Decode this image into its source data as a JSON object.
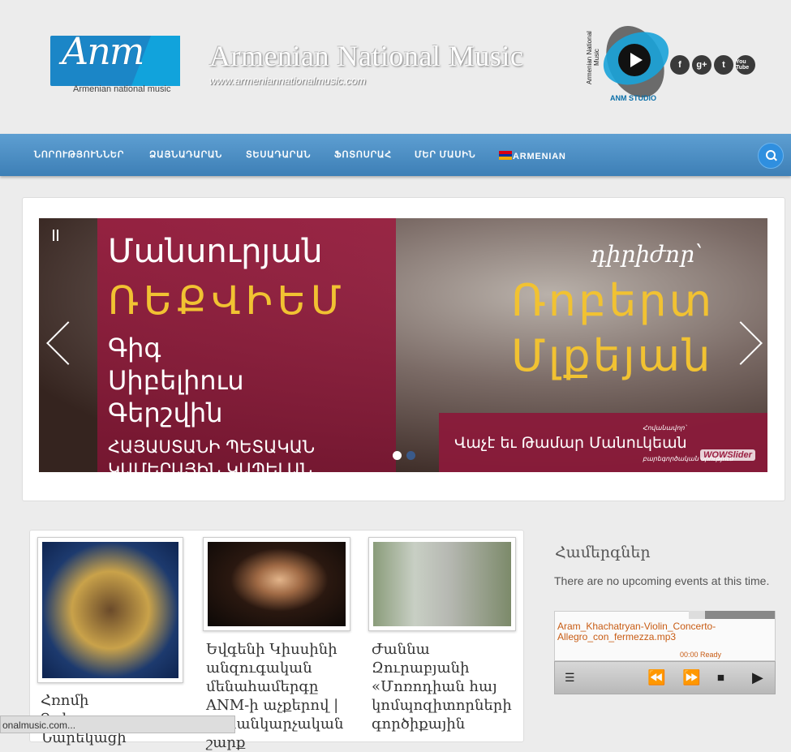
{
  "header": {
    "logo_script": "Anm",
    "logo_subtitle": "Armenian national music",
    "site_title": "Armenian National Music",
    "site_url": "www.armeniannationalmusic.com",
    "studio_vertical": "Armenian National Music",
    "studio_label": "ANM STUDIO",
    "social": [
      "f",
      "g+",
      "t",
      "You Tube"
    ]
  },
  "nav": {
    "items": [
      "ՆՈՐՈՒԹՅՈՒՆՆԵՐ",
      "ՁԱՅՆԱԴԱՐԱՆ",
      "ՏԵՍԱԴԱՐԱՆ",
      "ՖՈՏՈՍՐԱՀ",
      "ՄԵՐ ՄԱՍԻՆ"
    ],
    "language": "ARMENIAN",
    "flag_colors": [
      "#d90012",
      "#0033a0",
      "#f2a800"
    ]
  },
  "slider": {
    "line1": "Մանսուրյան",
    "line2": "ՌԵՔՎԻԵՄ",
    "line3a": "Գիգ",
    "line3b": "Սիբելիուս",
    "line3c": "Գերշվին",
    "line4a": "ՀԱՅԱՍՏԱՆԻ ՊԵՏԱԿԱՆ",
    "line4b": "ԿԱՄԵՐԱՅԻՆ ԿԱՊԵԼԱՆ",
    "conductor_label": "դիրիժոր՝",
    "conductor_name_1": "Ռոբերտ",
    "conductor_name_2": "Մլքեյան",
    "sponsor": "Վաչէ եւ Թամար Մանուկեան",
    "sponsor_top": "Հովանավոր՝",
    "sponsor_bottom": "բարեգործական միություն",
    "watermark": "WOWSlider",
    "active_slide": 1,
    "slide_count": 2
  },
  "posts": [
    {
      "title": "Հռոմի\nԳրիգոր\nՆարեկացի"
    },
    {
      "title": "Եվգենի Կիսսինի\nանզուգական\nմենահամերգը\nANM-ի աչքերով |\nլուսանկարչական շարք"
    },
    {
      "title": "Ժաննա\nԶուրաբյանի\n«Մոռոդիան հայ\nկոմպոզիտորների\nգործիքային"
    }
  ],
  "sidebar": {
    "events_title": "Համերգներ",
    "events_text": "There are no upcoming events at this time.",
    "player_track": "Aram_Khachatryan-Violin_Concerto-Allegro_con_fermezza.mp3",
    "player_status": "00:00 Ready"
  },
  "status_bar": "onalmusic.com..."
}
